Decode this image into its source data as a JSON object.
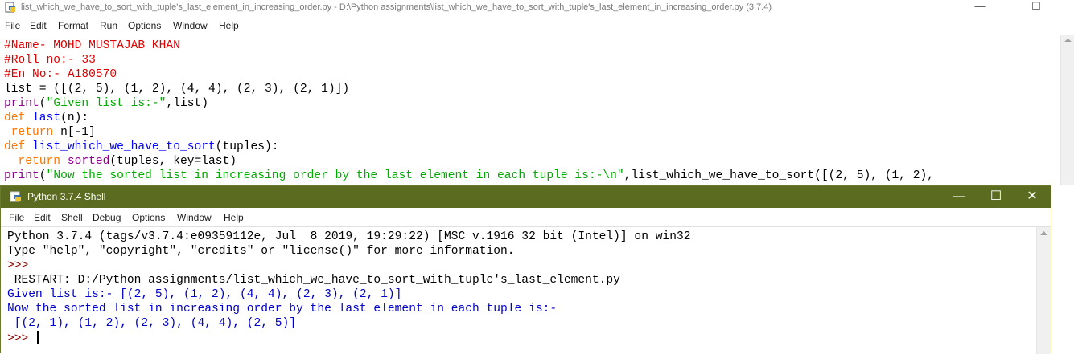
{
  "editor_window": {
    "title": "list_which_we_have_to_sort_with_tuple's_last_element_in_increasing_order.py - D:\\Python assignments\\list_which_we_have_to_sort_with_tuple's_last_element_in_increasing_order.py (3.7.4)",
    "menu": [
      "File",
      "Edit",
      "Format",
      "Run",
      "Options",
      "Window",
      "Help"
    ],
    "controls": {
      "minimize": "—",
      "maximize": "☐",
      "close": "✕"
    }
  },
  "code": {
    "line1": "#Name- MOHD MUSTAJAB KHAN",
    "line2": "#Roll no:- 33",
    "line3": "#En No:- A180570",
    "line4": "list = ([(2, 5), (1, 2), (4, 4), (2, 3), (2, 1)])",
    "line5_func": "print",
    "line5_str": "\"Given list is:-\"",
    "line5_rest": ",list)",
    "line6_kw": "def",
    "line6_name": "last",
    "line6_rest": "(n):",
    "line7_kw": "return",
    "line7_rest": " n[-1]",
    "line8_kw": "def",
    "line8_name": "list_which_we_have_to_sort",
    "line8_rest": "(tuples):",
    "line9_kw": "return",
    "line9_func": "sorted",
    "line9_rest": "(tuples, key=last)",
    "line10_func": "print",
    "line10_str": "\"Now the sorted list in increasing order by the last element in each tuple is:-\\n\"",
    "line10_rest": ",list_which_we_have_to_sort([(2, 5), (1, 2),"
  },
  "shell_window": {
    "title": "Python 3.7.4 Shell",
    "menu": [
      "File",
      "Edit",
      "Shell",
      "Debug",
      "Options",
      "Window",
      "Help"
    ],
    "controls": {
      "minimize": "—",
      "maximize": "☐",
      "close": "✕"
    }
  },
  "shell": {
    "banner1": "Python 3.7.4 (tags/v3.7.4:e09359112e, Jul  8 2019, 19:29:22) [MSC v.1916 32 bit (Intel)] on win32",
    "banner2": "Type \"help\", \"copyright\", \"credits\" or \"license()\" for more information.",
    "prompt1": ">>> ",
    "restart": " RESTART: D:/Python assignments/list_which_we_have_to_sort_with_tuple's_last_element.py",
    "out1": "Given list is:- [(2, 5), (1, 2), (4, 4), (2, 3), (2, 1)]",
    "out2": "Now the sorted list in increasing order by the last element in each tuple is:-",
    "out3": " [(2, 1), (1, 2), (2, 3), (4, 4), (2, 5)]",
    "prompt2": ">>> "
  },
  "colors": {
    "comment": "#dd0000",
    "keyword": "#ff7700",
    "builtin": "#900090",
    "string": "#00aa00",
    "definition": "#0000ff",
    "stdout": "#0000cc",
    "shell_titlebar": "#5b6b1f"
  }
}
